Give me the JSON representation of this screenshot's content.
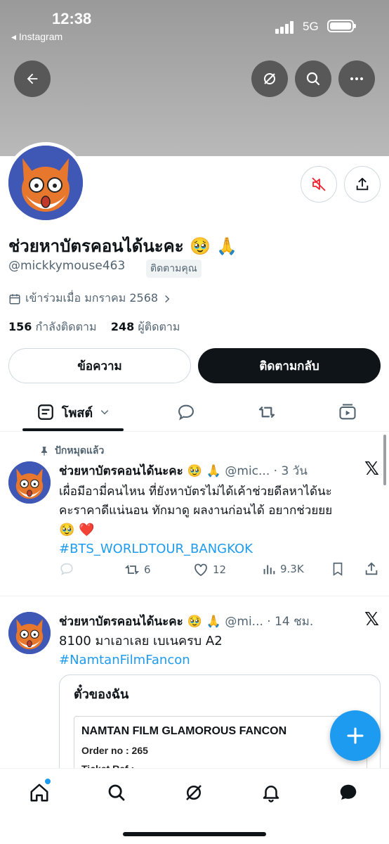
{
  "status_bar": {
    "time": "12:38",
    "back_app": "◂ Instagram",
    "network": "5G"
  },
  "profile": {
    "display_name": "ช่วยหาบัตรคอนได้นะคะ 🥹 🙏",
    "handle": "@mickkymouse463",
    "follows_you": "ติดตามคุณ",
    "joined": "เข้าร่วมเมื่อ มกราคม 2568",
    "following_count": "156",
    "following_label": "กำลังติดตาม",
    "followers_count": "248",
    "followers_label": "ผู้ติดตาม",
    "message_button": "ข้อความ",
    "follow_back_button": "ติดตามกลับ"
  },
  "tabs": {
    "posts_label": "โพสต์"
  },
  "tweets": [
    {
      "pinned_label": "ปักหมุดแล้ว",
      "name": "ช่วยหาบัตรคอนได้นะคะ 🥹 🙏",
      "meta": " @mic... · 3 วัน",
      "body_line1": "เผื่อมีอามี่คนไหน ที่ยังหาบัตรไม่ได้เค้าช่วยดีลหาได้นะ",
      "body_line2": "คะราคาดีแน่นอน ทักมาดู ผลงานก่อนได้ อยากช่วยยย",
      "body_line3": "🥹 ❤️",
      "hashtag": "#BTS_WORLDTOUR_BANGKOK",
      "retweets": "6",
      "likes": "12",
      "views": "9.3K"
    },
    {
      "name": "ช่วยหาบัตรคอนได้นะคะ 🥹 🙏",
      "meta": " @mi... · 14 ชม.",
      "body_line1": "8100 มาเอาเลย เบเนครบ A2",
      "hashtag": "#NamtanFilmFancon",
      "card_title": "ตั๋วของฉัน",
      "ticket_title": "NAMTAN FILM GLAMOROUS FANCON",
      "ticket_order": "Order no : 265",
      "ticket_ref": "Ticket Ref :"
    }
  ],
  "colors": {
    "accent": "#1d9bf0",
    "text": "#0f1419",
    "muted": "#536471",
    "mute_red": "#f4212e"
  }
}
